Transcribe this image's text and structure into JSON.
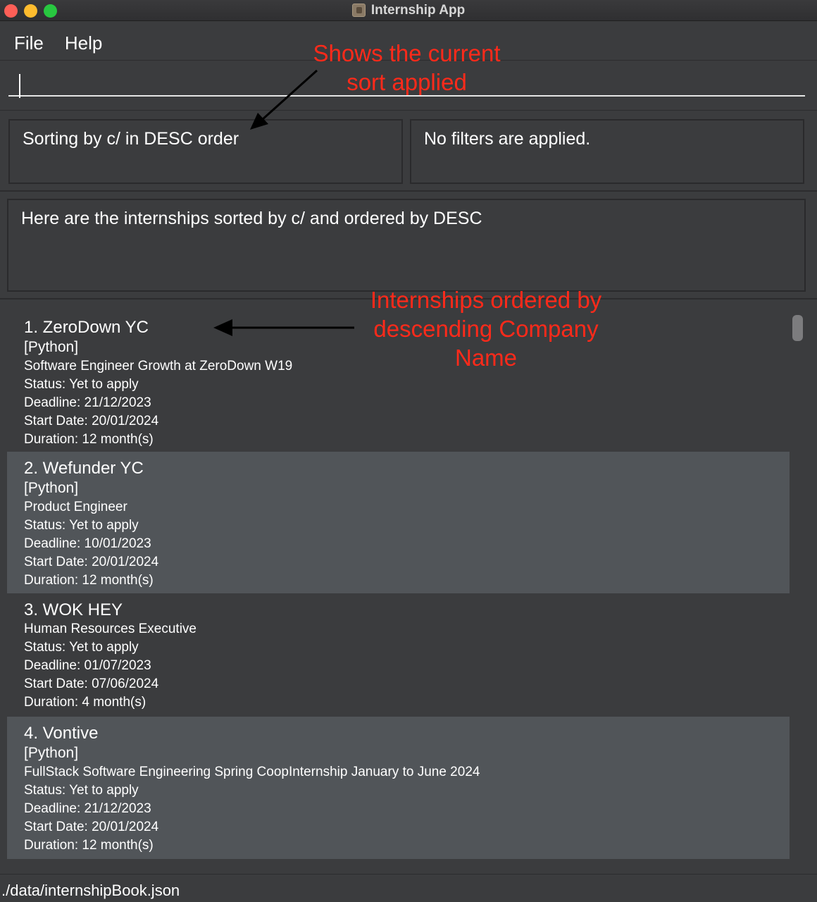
{
  "window": {
    "title": "Internship App",
    "icon": "app-icon"
  },
  "menu": {
    "items": [
      {
        "label": "File"
      },
      {
        "label": "Help"
      }
    ]
  },
  "command": {
    "value": ""
  },
  "sort_panel": {
    "text": "Sorting by c/ in DESC order"
  },
  "filter_panel": {
    "text": "No filters are applied."
  },
  "result_panel": {
    "text": "Here are the internships sorted by c/ and ordered by DESC"
  },
  "internships": [
    {
      "title": "1.  ZeroDown YC",
      "tag": "[Python]",
      "role": "Software Engineer Growth at ZeroDown W19",
      "status": "Status: Yet to apply",
      "deadline": "Deadline: 21/12/2023",
      "start": "Start Date: 20/01/2024",
      "duration": "Duration: 12 month(s)"
    },
    {
      "title": "2.  Wefunder YC",
      "tag": "[Python]",
      "role": "Product Engineer",
      "status": "Status: Yet to apply",
      "deadline": "Deadline: 10/01/2023",
      "start": "Start Date: 20/01/2024",
      "duration": "Duration: 12 month(s)"
    },
    {
      "title": "3.  WOK HEY",
      "tag": "",
      "role": "Human Resources Executive",
      "status": "Status: Yet to apply",
      "deadline": "Deadline: 01/07/2023",
      "start": "Start Date: 07/06/2024",
      "duration": "Duration: 4 month(s)"
    },
    {
      "title": "4.  Vontive",
      "tag": "[Python]",
      "role": "FullStack Software Engineering Spring CoopInternship January to June 2024",
      "status": "Status: Yet to apply",
      "deadline": "Deadline: 21/12/2023",
      "start": "Start Date: 20/01/2024",
      "duration": "Duration: 12 month(s)"
    }
  ],
  "footer": {
    "path": "./data/internshipBook.json"
  },
  "annotations": {
    "sort": "Shows the current sort applied",
    "list": "Internships ordered by descending Company Name"
  },
  "colors": {
    "background": "#3b3c3e",
    "alt_row": "#515559",
    "annotation": "#ff2a1a"
  }
}
